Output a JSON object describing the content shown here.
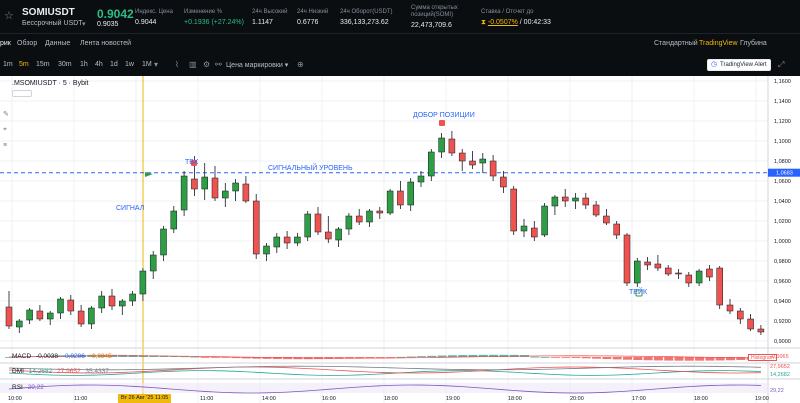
{
  "ticker": {
    "symbol": "SOMIUSDT",
    "subtitle": "Бессрочный USDT",
    "last_price": "0.9042",
    "last_price_secondary": "0.9035",
    "stats": [
      {
        "label": "Индекс. Цена",
        "value": "0.9044",
        "color": "default"
      },
      {
        "label": "Изменение %",
        "value": "+0.1936 (+27.24%)",
        "color": "green"
      },
      {
        "label": "24ч Высокий",
        "value": "1.1147",
        "color": "default"
      },
      {
        "label": "24ч Низкий",
        "value": "0.6776",
        "color": "default"
      },
      {
        "label": "24ч Оборот(USDT)",
        "value": "336,133,273.62",
        "color": "default"
      },
      {
        "label": "Сумма открытых позиций(SOMI)",
        "value": "22,473,709.6",
        "color": "default"
      },
      {
        "label": "Ставка / Отсчет до",
        "value_rate": "-0.0507%",
        "value_time": "/ 00:42:33",
        "color": "orange"
      }
    ]
  },
  "tabs": {
    "left": [
      "рик",
      "Обзор",
      "Данные",
      "Лента новостей"
    ],
    "right": [
      "Стандартный",
      "TradingView",
      "Глубина"
    ],
    "active_right": "TradingView"
  },
  "toolbar": {
    "timeframes": [
      "1m",
      "5m",
      "15m",
      "30m",
      "1h",
      "4h",
      "1d",
      "1w",
      "1M"
    ],
    "active_timeframe": "5m",
    "price_type": "Цена маркировки",
    "alert_button": "TradingView Alert"
  },
  "chart": {
    "title": ".MSOMIUSDT · 5 · Bybit",
    "current_price_label": "1,0683",
    "annotations": {
      "signal": "СИГНАЛ",
      "tvh": "ТВХ",
      "signal_level": "СИГНАЛЬНЫЙ УРОВЕНЬ",
      "add_position": "ДОБОР ПОЗИЦИИ",
      "take": "ТЕЙК"
    },
    "price_ticks": [
      "1,1600",
      "1,1400",
      "1,1200",
      "1,1000",
      "1,0800",
      "1,0600",
      "1,0400",
      "1,0200",
      "1,0000",
      "0,9800",
      "0,9600",
      "0,9400",
      "0,9200",
      "0,9000"
    ],
    "time_ticks": [
      "10:00",
      "11:00",
      "11:00",
      "14:00",
      "16:00",
      "18:00",
      "19:00",
      "18:00",
      "20:00",
      "17:00",
      "18:00",
      "19:00",
      "20:00"
    ],
    "time_badge": "Вт 26 Авг '25  11:05"
  },
  "indicators": {
    "macd": {
      "name": "MACD",
      "v1": "-0,0038",
      "v2": "-0,0206",
      "v3": "-0,0245",
      "badge": "Histogram",
      "scale": [
        "-0,0065"
      ]
    },
    "dmi": {
      "name": "DMI",
      "v1": "14,2682",
      "v2": "27,9652",
      "v3": "35,4337",
      "scale": [
        "27,9652",
        "14,2682"
      ]
    },
    "rsi": {
      "name": "RSI",
      "v1": "29,22",
      "scale": [
        "29,22"
      ]
    }
  },
  "colors": {
    "up": "#26a69a",
    "up_candle": "#2e9e44",
    "down": "#ef5350",
    "accent": "#f0b90b",
    "level": "#2962ff",
    "positive": "#2ebd85"
  },
  "chart_data": {
    "type": "candlestick",
    "ylim": [
      0.895,
      1.165
    ],
    "candles": [
      [
        0.934,
        0.95,
        0.912,
        0.915
      ],
      [
        0.914,
        0.922,
        0.908,
        0.92
      ],
      [
        0.921,
        0.933,
        0.917,
        0.931
      ],
      [
        0.93,
        0.936,
        0.92,
        0.922
      ],
      [
        0.922,
        0.93,
        0.916,
        0.928
      ],
      [
        0.928,
        0.944,
        0.922,
        0.942
      ],
      [
        0.941,
        0.946,
        0.926,
        0.93
      ],
      [
        0.93,
        0.936,
        0.914,
        0.917
      ],
      [
        0.917,
        0.935,
        0.912,
        0.933
      ],
      [
        0.933,
        0.95,
        0.928,
        0.945
      ],
      [
        0.945,
        0.952,
        0.931,
        0.935
      ],
      [
        0.935,
        0.942,
        0.926,
        0.94
      ],
      [
        0.94,
        0.95,
        0.935,
        0.947
      ],
      [
        0.947,
        0.973,
        0.94,
        0.97
      ],
      [
        0.97,
        0.99,
        0.962,
        0.986
      ],
      [
        0.986,
        1.015,
        0.98,
        1.012
      ],
      [
        1.012,
        1.035,
        1.008,
        1.03
      ],
      [
        1.031,
        1.07,
        1.025,
        1.065
      ],
      [
        1.062,
        1.085,
        1.045,
        1.052
      ],
      [
        1.052,
        1.078,
        1.041,
        1.064
      ],
      [
        1.063,
        1.075,
        1.04,
        1.043
      ],
      [
        1.043,
        1.058,
        1.034,
        1.05
      ],
      [
        1.05,
        1.062,
        1.04,
        1.058
      ],
      [
        1.057,
        1.065,
        1.038,
        1.04
      ],
      [
        1.04,
        1.047,
        0.982,
        0.987
      ],
      [
        0.987,
        0.998,
        0.98,
        0.995
      ],
      [
        0.994,
        1.008,
        0.988,
        1.004
      ],
      [
        1.004,
        1.01,
        0.992,
        0.998
      ],
      [
        0.998,
        1.008,
        0.995,
        1.004
      ],
      [
        1.004,
        1.03,
        1.0,
        1.027
      ],
      [
        1.027,
        1.034,
        1.006,
        1.009
      ],
      [
        1.009,
        1.025,
        0.998,
        1.002
      ],
      [
        1.001,
        1.014,
        0.994,
        1.012
      ],
      [
        1.012,
        1.028,
        1.006,
        1.025
      ],
      [
        1.025,
        1.032,
        1.016,
        1.019
      ],
      [
        1.019,
        1.032,
        1.014,
        1.03
      ],
      [
        1.03,
        1.034,
        1.022,
        1.028
      ],
      [
        1.028,
        1.052,
        1.026,
        1.05
      ],
      [
        1.05,
        1.06,
        1.032,
        1.036
      ],
      [
        1.036,
        1.063,
        1.03,
        1.059
      ],
      [
        1.059,
        1.07,
        1.054,
        1.065
      ],
      [
        1.065,
        1.092,
        1.06,
        1.089
      ],
      [
        1.089,
        1.108,
        1.083,
        1.103
      ],
      [
        1.102,
        1.11,
        1.085,
        1.088
      ],
      [
        1.088,
        1.092,
        1.07,
        1.08
      ],
      [
        1.08,
        1.09,
        1.072,
        1.076
      ],
      [
        1.078,
        1.088,
        1.068,
        1.082
      ],
      [
        1.08,
        1.086,
        1.06,
        1.065
      ],
      [
        1.064,
        1.07,
        1.048,
        1.054
      ],
      [
        1.052,
        1.055,
        1.006,
        1.01
      ],
      [
        1.01,
        1.022,
        1.004,
        1.015
      ],
      [
        1.013,
        1.02,
        1.0,
        1.004
      ],
      [
        1.006,
        1.038,
        1.004,
        1.035
      ],
      [
        1.035,
        1.046,
        1.026,
        1.044
      ],
      [
        1.044,
        1.052,
        1.034,
        1.04
      ],
      [
        1.04,
        1.048,
        1.032,
        1.043
      ],
      [
        1.043,
        1.048,
        1.032,
        1.036
      ],
      [
        1.036,
        1.04,
        1.024,
        1.026
      ],
      [
        1.025,
        1.032,
        1.016,
        1.018
      ],
      [
        1.017,
        1.02,
        1.002,
        1.006
      ],
      [
        1.006,
        1.008,
        0.955,
        0.958
      ],
      [
        0.958,
        0.983,
        0.954,
        0.98
      ],
      [
        0.979,
        0.984,
        0.971,
        0.976
      ],
      [
        0.977,
        0.986,
        0.97,
        0.973
      ],
      [
        0.973,
        0.976,
        0.965,
        0.967
      ],
      [
        0.968,
        0.972,
        0.962,
        0.967
      ],
      [
        0.966,
        0.969,
        0.954,
        0.958
      ],
      [
        0.958,
        0.972,
        0.955,
        0.97
      ],
      [
        0.972,
        0.976,
        0.96,
        0.964
      ],
      [
        0.973,
        0.975,
        0.932,
        0.936
      ],
      [
        0.936,
        0.942,
        0.927,
        0.93
      ],
      [
        0.93,
        0.933,
        0.917,
        0.922
      ],
      [
        0.922,
        0.927,
        0.91,
        0.912
      ],
      [
        0.912,
        0.916,
        0.906,
        0.909
      ]
    ],
    "signal_level": 1.0683
  }
}
